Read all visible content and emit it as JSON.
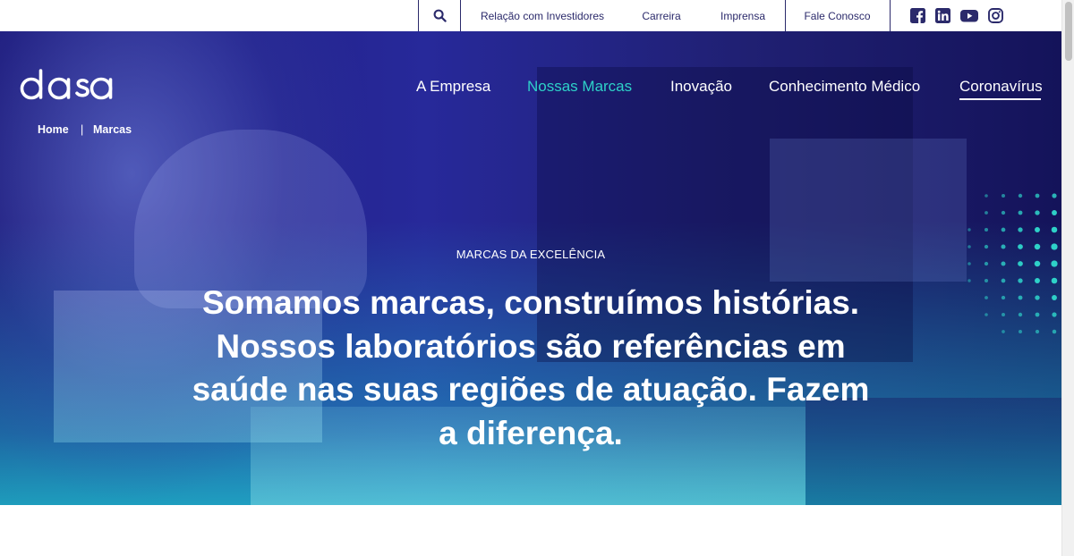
{
  "topbar": {
    "links": [
      {
        "label": "Relação com Investidores"
      },
      {
        "label": "Carreira"
      },
      {
        "label": "Imprensa"
      },
      {
        "label": "Fale Conosco"
      }
    ],
    "social_icons": [
      "facebook-icon",
      "linkedin-icon",
      "youtube-icon",
      "instagram-icon"
    ]
  },
  "nav": {
    "items": [
      {
        "label": "A Empresa"
      },
      {
        "label": "Nossas Marcas"
      },
      {
        "label": "Inovação"
      },
      {
        "label": "Conhecimento Médico"
      },
      {
        "label": "Coronavírus"
      }
    ],
    "active_label": "Nossas Marcas",
    "underlined_label": "Coronavírus"
  },
  "breadcrumb": {
    "home": "Home",
    "separator": "|",
    "current": "Marcas"
  },
  "hero": {
    "eyebrow": "MARCAS DA EXCELÊNCIA",
    "headline_lines": [
      "Somamos marcas, construímos histórias.",
      "Nossos laboratórios são referências em",
      "saúde nas suas regiões de atuação. Fazem",
      "a diferença."
    ]
  },
  "colors": {
    "brand_navy": "#2b2a6b",
    "accent_teal": "#2ed1c8",
    "hero_deep": "#1c1878"
  }
}
